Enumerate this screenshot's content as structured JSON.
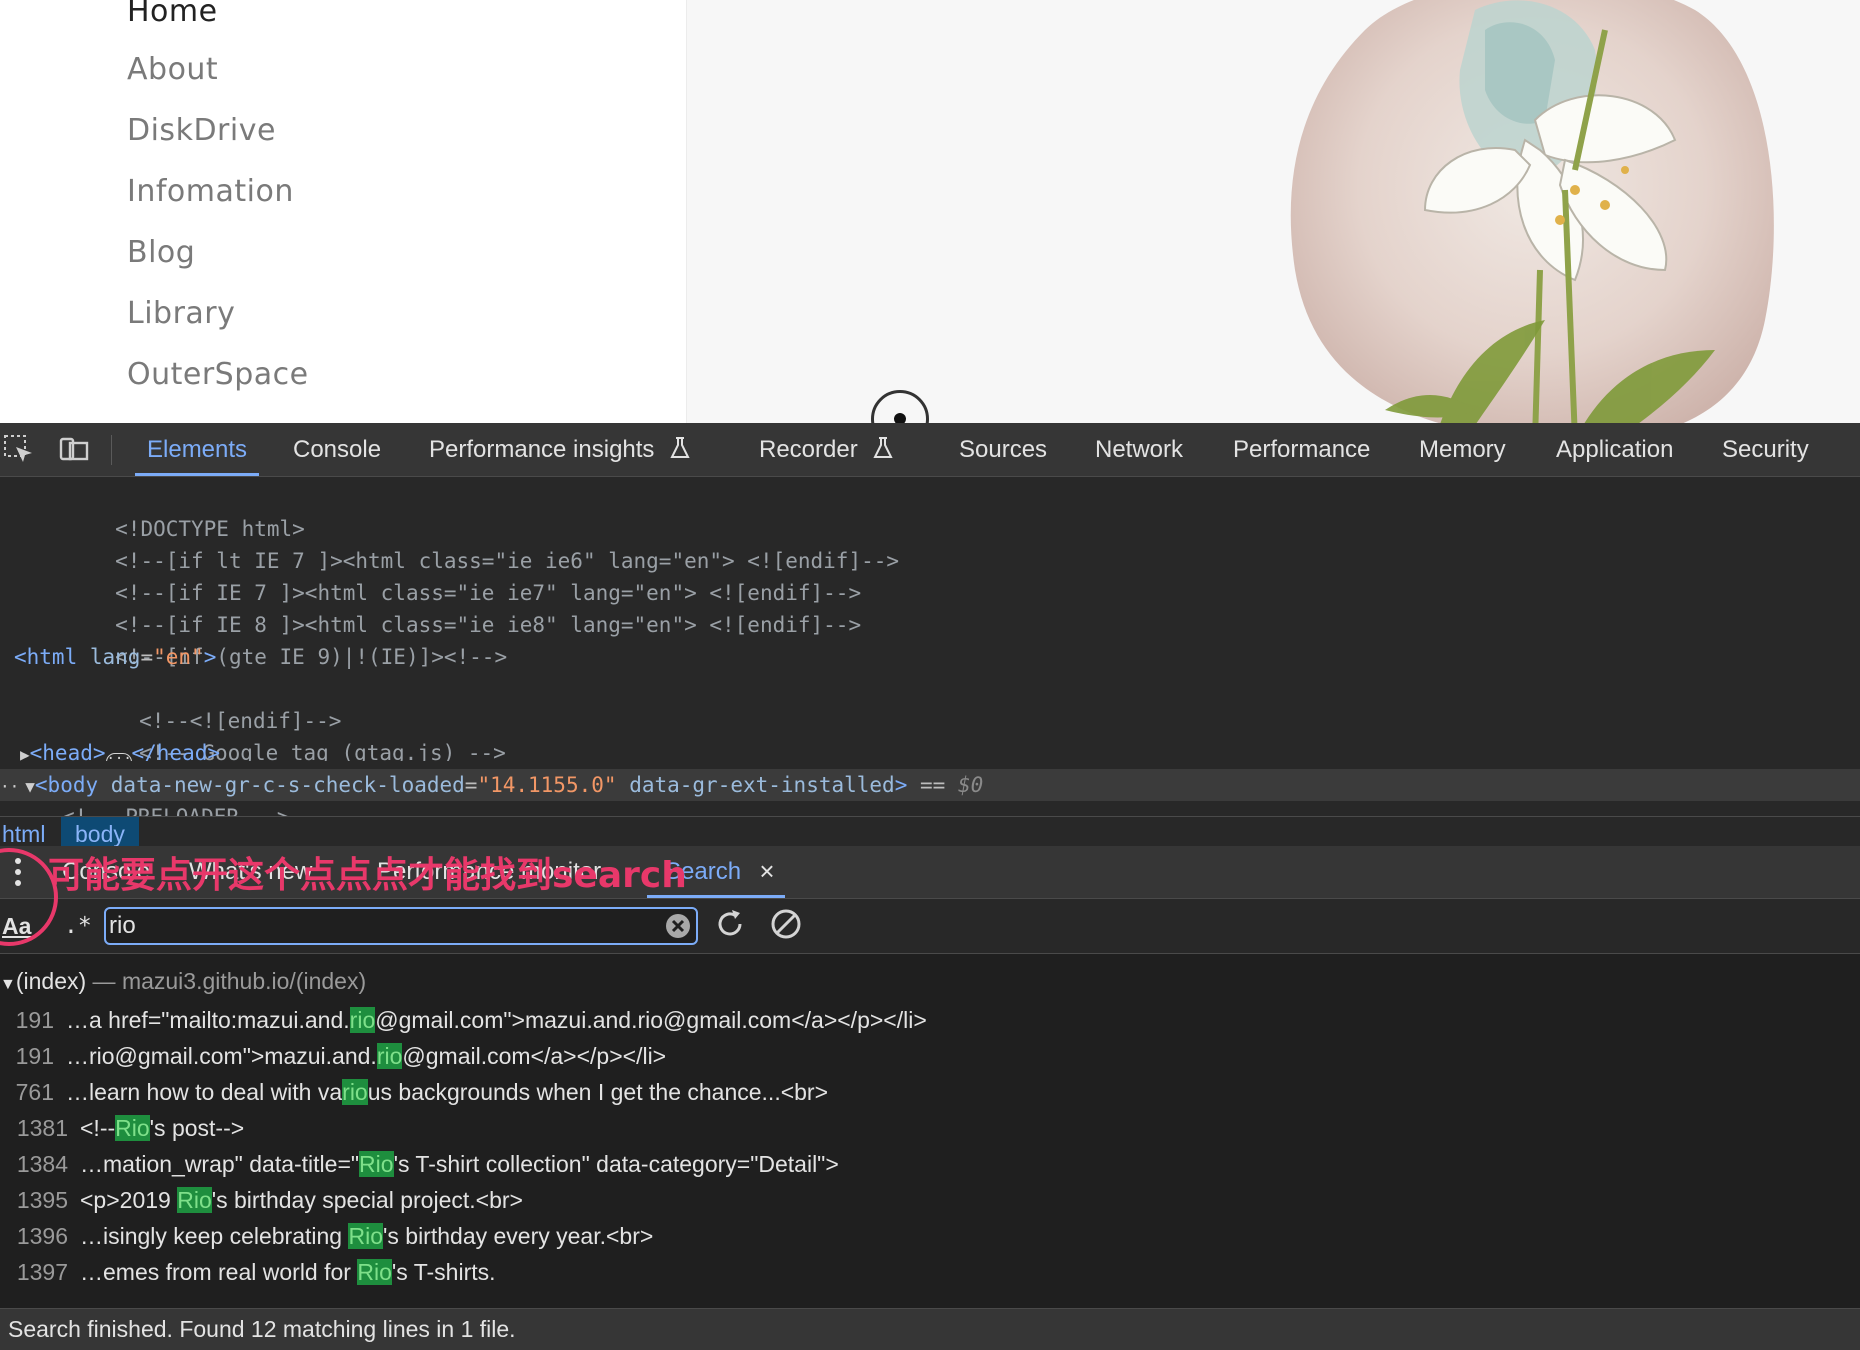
{
  "webpage": {
    "nav": [
      "Home",
      "About",
      "DiskDrive",
      "Infomation",
      "Blog",
      "Library",
      "OuterSpace"
    ]
  },
  "devtools": {
    "tabs": [
      "Elements",
      "Console",
      "Performance insights",
      "Recorder",
      "Sources",
      "Network",
      "Performance",
      "Memory",
      "Application",
      "Security"
    ],
    "active_tab": "Elements",
    "dom": {
      "doctype": "<!DOCTYPE html>",
      "cond1": "<!--[if lt IE 7 ]><html class=\"ie ie6\" lang=\"en\"> <![endif]-->",
      "cond2": "<!--[if IE 7 ]><html class=\"ie ie7\" lang=\"en\"> <![endif]-->",
      "cond3": "<!--[if IE 8 ]><html class=\"ie ie8\" lang=\"en\"> <![endif]-->",
      "cond4": "<!--[if (gte IE 9)|!(IE)]><!-->",
      "html_open_tag": "<html",
      "html_lang_attr": "lang",
      "html_lang_val": "\"en\"",
      "html_close": ">",
      "endif_comment": "<!--<![endif]-->",
      "gtag_comment": "<!-- Google tag (gtag.js) -->",
      "head_open": "<head>",
      "head_close": "</head>",
      "body_open": "<body",
      "body_attr1": "data-new-gr-c-s-check-loaded",
      "body_val1": "\"14.1155.0\"",
      "body_attr2": "data-gr-ext-installed",
      "body_close": ">",
      "body_eq": "==",
      "body_dollar": "$0",
      "preloader": "<!-- PRELOADER -->"
    },
    "breadcrumb": [
      "html",
      "body"
    ],
    "drawer": {
      "tabs": [
        "Console",
        "What's new",
        "Performance monitor",
        "Search"
      ],
      "active_tab": "Search",
      "annotation": "可能要点开这个点点点才能找到search"
    },
    "search": {
      "case_label": "Aa",
      "regex_label": ".*",
      "query": "rio",
      "file_name": "(index)",
      "file_sep": "—",
      "file_path": "mazui3.github.io/(index)",
      "results": [
        {
          "line": "191",
          "before": "…a href=\"mailto:mazui.and.",
          "match": "rio",
          "after": "@gmail.com\">mazui.and.rio@gmail.com</a></p></li>"
        },
        {
          "line": "191",
          "before": "…rio@gmail.com\">mazui.and.",
          "match": "rio",
          "after": "@gmail.com</a></p></li>"
        },
        {
          "line": "761",
          "before": "…learn how to deal with va",
          "match": "rio",
          "after": "us backgrounds when I get the chance...<br>"
        },
        {
          "line": "1381",
          "before": "<!--",
          "match": "Rio",
          "after": "'s post-->"
        },
        {
          "line": "1384",
          "before": "…mation_wrap\" data-title=\"",
          "match": "Rio",
          "after": "'s T-shirt collection\" data-category=\"Detail\">"
        },
        {
          "line": "1395",
          "before": "<p>2019 ",
          "match": "Rio",
          "after": "'s birthday special project.<br>"
        },
        {
          "line": "1396",
          "before": "…isingly keep celebrating ",
          "match": "Rio",
          "after": "'s birthday every year.<br>"
        },
        {
          "line": "1397",
          "before": "…emes from real world for ",
          "match": "Rio",
          "after": "'s T-shirts."
        }
      ],
      "status": "Search finished.  Found 12 matching lines in 1 file."
    }
  },
  "colors": {
    "accent": "#7cacf8",
    "match_bg": "#1e8e3e",
    "annotation": "#e8386a"
  }
}
